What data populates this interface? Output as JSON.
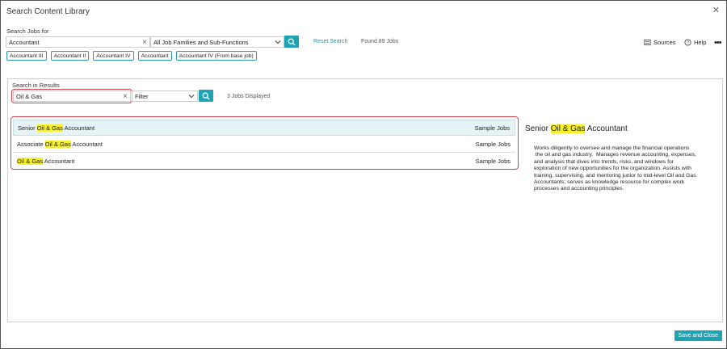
{
  "dialog": {
    "title": "Search Content Library"
  },
  "search_jobs": {
    "label": "Search Jobs for",
    "value": "Accountant",
    "family_select": "All Job Families and Sub-Functions",
    "reset_label": "Reset Search",
    "found_text": "Found 89 Jobs"
  },
  "chips": [
    "Accountant III",
    "Accountant II",
    "Accountant IV",
    "Accountant",
    "Accountant IV (From base job)"
  ],
  "toolbar": {
    "sources_label": "Sources",
    "help_label": "Help",
    "more_icon": "ellipsis-icon"
  },
  "results_search": {
    "label": "Search in Results",
    "value": "Oil & Gas",
    "filter_select": "Filter",
    "displayed_text": "3 Jobs Displayed"
  },
  "results": [
    {
      "prefix": "Senior ",
      "highlight": "Oil & Gas",
      "suffix": " Accountant",
      "source": "Sample Jobs"
    },
    {
      "prefix": "Associate ",
      "highlight": "Oil & Gas",
      "suffix": " Accountant",
      "source": "Sample Jobs"
    },
    {
      "prefix": "",
      "highlight": "Oil & Gas",
      "suffix": " Accountant",
      "source": "Sample Jobs"
    }
  ],
  "detail": {
    "title_prefix": "Senior ",
    "title_highlight": "Oil & Gas",
    "title_suffix": " Accountant",
    "description": "Works diligently to oversee and manage the financial operations\n the oil and gas industry.  Manages revenue accounting, expenses,\nand analysis that dives into trends, risks, and windows for\nexploration of new opportunities for the organization. Assists with\ntraining, supervising, and mentoring junior to mid-level Oil and Gas\nAccountants; serves as knowledge resource for complex work\nprocesses and accounting principles."
  },
  "footer": {
    "save_label": "Save and Close"
  },
  "colors": {
    "accent": "#1ea3b5",
    "highlight": "#f6f12a",
    "callout": "#d0444f"
  }
}
